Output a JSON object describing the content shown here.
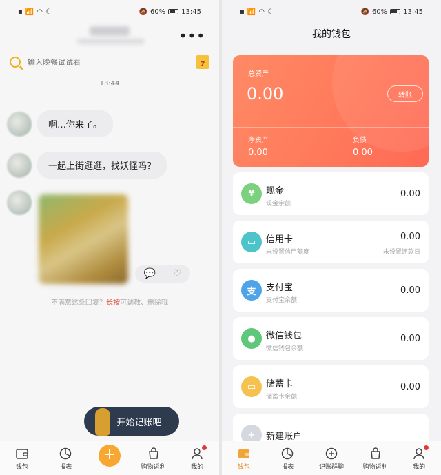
{
  "status_bar": {
    "left": "📶 ᴴᴰ ▮▮▮",
    "battery": "60%",
    "time": "13:45"
  },
  "chat": {
    "search_placeholder": "输入晚餐试试看",
    "calendar_day": "7",
    "time_label": "13:44",
    "messages": [
      "啊…你来了。",
      "一起上街逛逛，找妖怪吗？"
    ],
    "hint_prefix": "不满意这条回复？",
    "hint_action": "长按",
    "hint_suffix": "可调教、删除哦",
    "start_button": "开始记账吧"
  },
  "left_tabs": [
    "钱包",
    "报表",
    "购物返利",
    "我的"
  ],
  "right_tabs": [
    "钱包",
    "报表",
    "记账群聊",
    "购物返利",
    "我的"
  ],
  "wallet": {
    "title": "我的钱包",
    "total_label": "总资产",
    "total_value": "0.00",
    "transfer": "转账",
    "net_label": "净资产",
    "net_value": "0.00",
    "debt_label": "负债",
    "debt_value": "0.00",
    "accounts": [
      {
        "name": "现金",
        "sub": "现金余额",
        "value": "0.00",
        "color": "#7bd17f"
      },
      {
        "name": "信用卡",
        "sub": "未设置信用额度",
        "value": "0.00",
        "right_sub": "未设置还款日",
        "color": "#4dc4c9"
      },
      {
        "name": "支付宝",
        "sub": "支付宝余额",
        "value": "0.00",
        "color": "#4fa3e8"
      },
      {
        "name": "微信钱包",
        "sub": "微信钱包余额",
        "value": "0.00",
        "color": "#5fc77a"
      },
      {
        "name": "储蓄卡",
        "sub": "储蓄卡余额",
        "value": "0.00",
        "color": "#f5c24f"
      }
    ],
    "new_account": "新建账户"
  }
}
